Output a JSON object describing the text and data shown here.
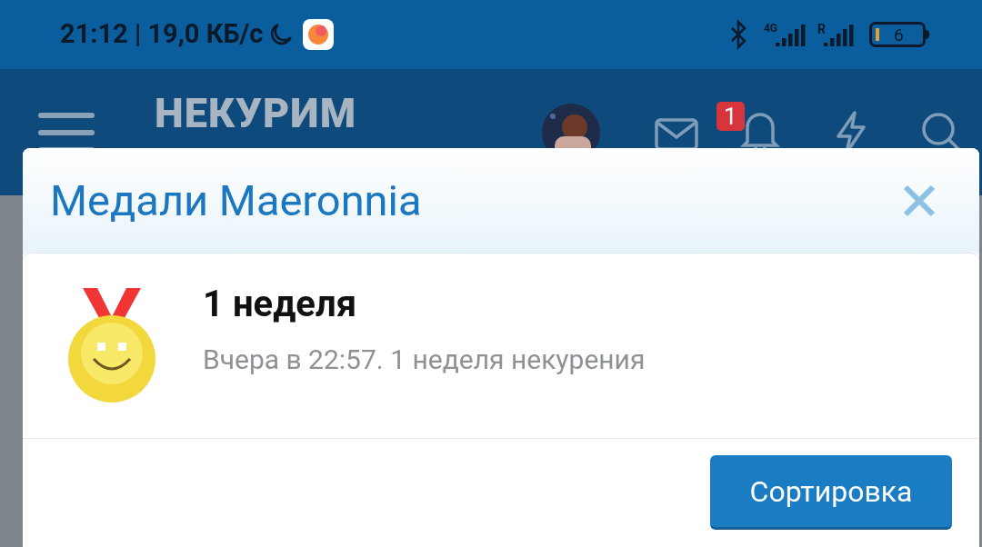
{
  "status_bar": {
    "time_speed": "21:12 | 19,0 КБ/с",
    "network_1": "4G",
    "network_2": "R",
    "battery": "6"
  },
  "header": {
    "logo": "НЕКУРИМ",
    "notification_count": "1"
  },
  "dialog": {
    "title": "Медали Maeronnia",
    "medals": [
      {
        "title": "1 неделя",
        "description": "Вчера в 22:57. 1 неделя некурения"
      }
    ],
    "button": "Сортировка"
  }
}
